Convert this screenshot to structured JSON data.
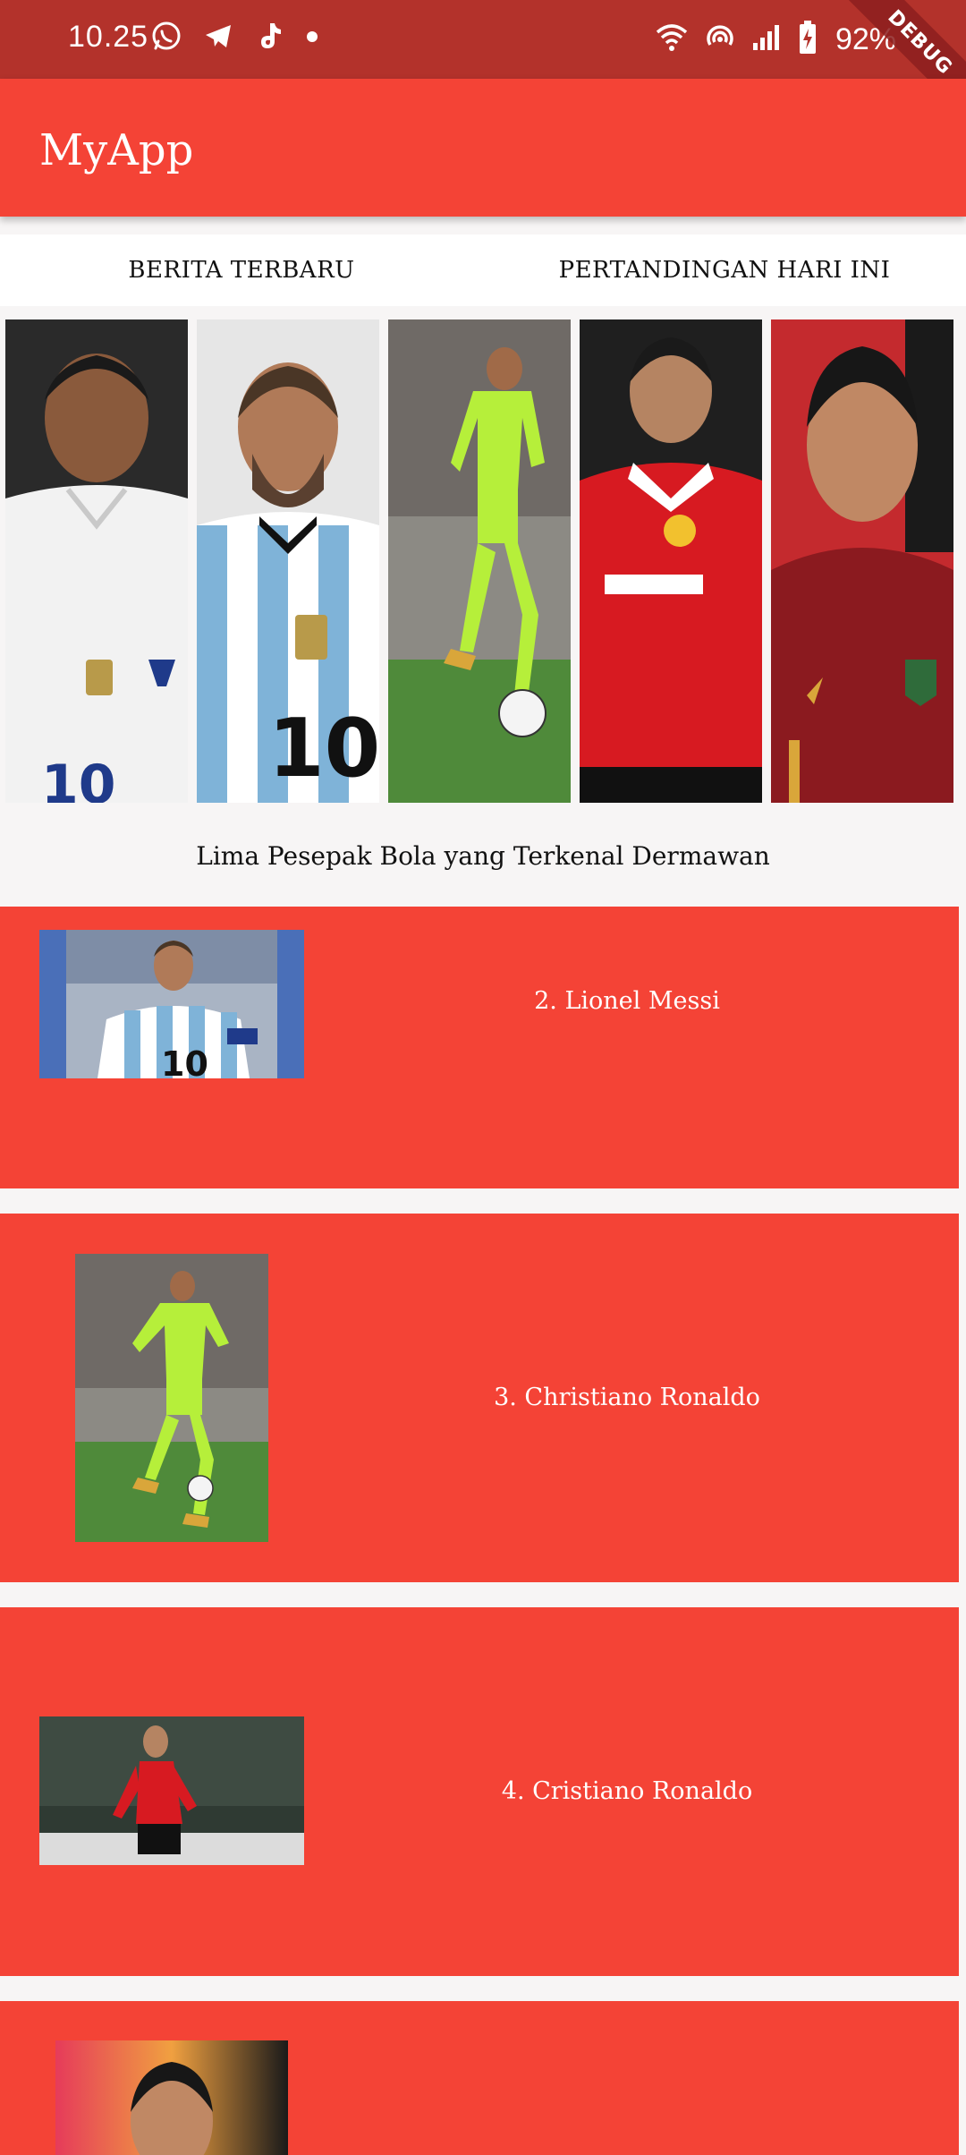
{
  "status_bar": {
    "time": "10.25",
    "battery": "92%",
    "icons_left": [
      "whatsapp-icon",
      "telegram-icon",
      "tiktok-icon",
      "dot-icon"
    ],
    "icons_right": [
      "wifi-icon",
      "hotspot-icon",
      "signal-icon",
      "battery-icon"
    ]
  },
  "debug_banner": "DEBUG",
  "app_bar": {
    "title": "MyApp"
  },
  "tabs": [
    {
      "label": "BERITA TERBARU"
    },
    {
      "label": "PERTANDINGAN HARI INI"
    }
  ],
  "gallery": {
    "tiles": [
      {
        "name": "player-photo-white-france-kit",
        "colors": [
          "#2a2a2a",
          "#f2f2f2"
        ]
      },
      {
        "name": "player-photo-argentina-kit",
        "colors": [
          "#e6e6e6",
          "#7fb3d8"
        ]
      },
      {
        "name": "player-photo-green-kit",
        "colors": [
          "#8aa36a",
          "#b6ef3a"
        ]
      },
      {
        "name": "player-photo-red-kit",
        "colors": [
          "#1f1f1f",
          "#d71a21"
        ]
      },
      {
        "name": "player-photo-portugal-kit",
        "colors": [
          "#c42a2e",
          "#8b1a1f"
        ]
      }
    ]
  },
  "section": {
    "title": "Lima Pesepak Bola yang Terkenal Dermawan"
  },
  "players": [
    {
      "label": "2. Lionel Messi"
    },
    {
      "label": "3. Christiano Ronaldo"
    },
    {
      "label": "4. Cristiano Ronaldo"
    },
    {
      "label": ""
    }
  ],
  "colors": {
    "status_bar": "#b3322b",
    "app_bar": "#f44336",
    "card": "#f44336",
    "background": "#f7f5f5"
  }
}
